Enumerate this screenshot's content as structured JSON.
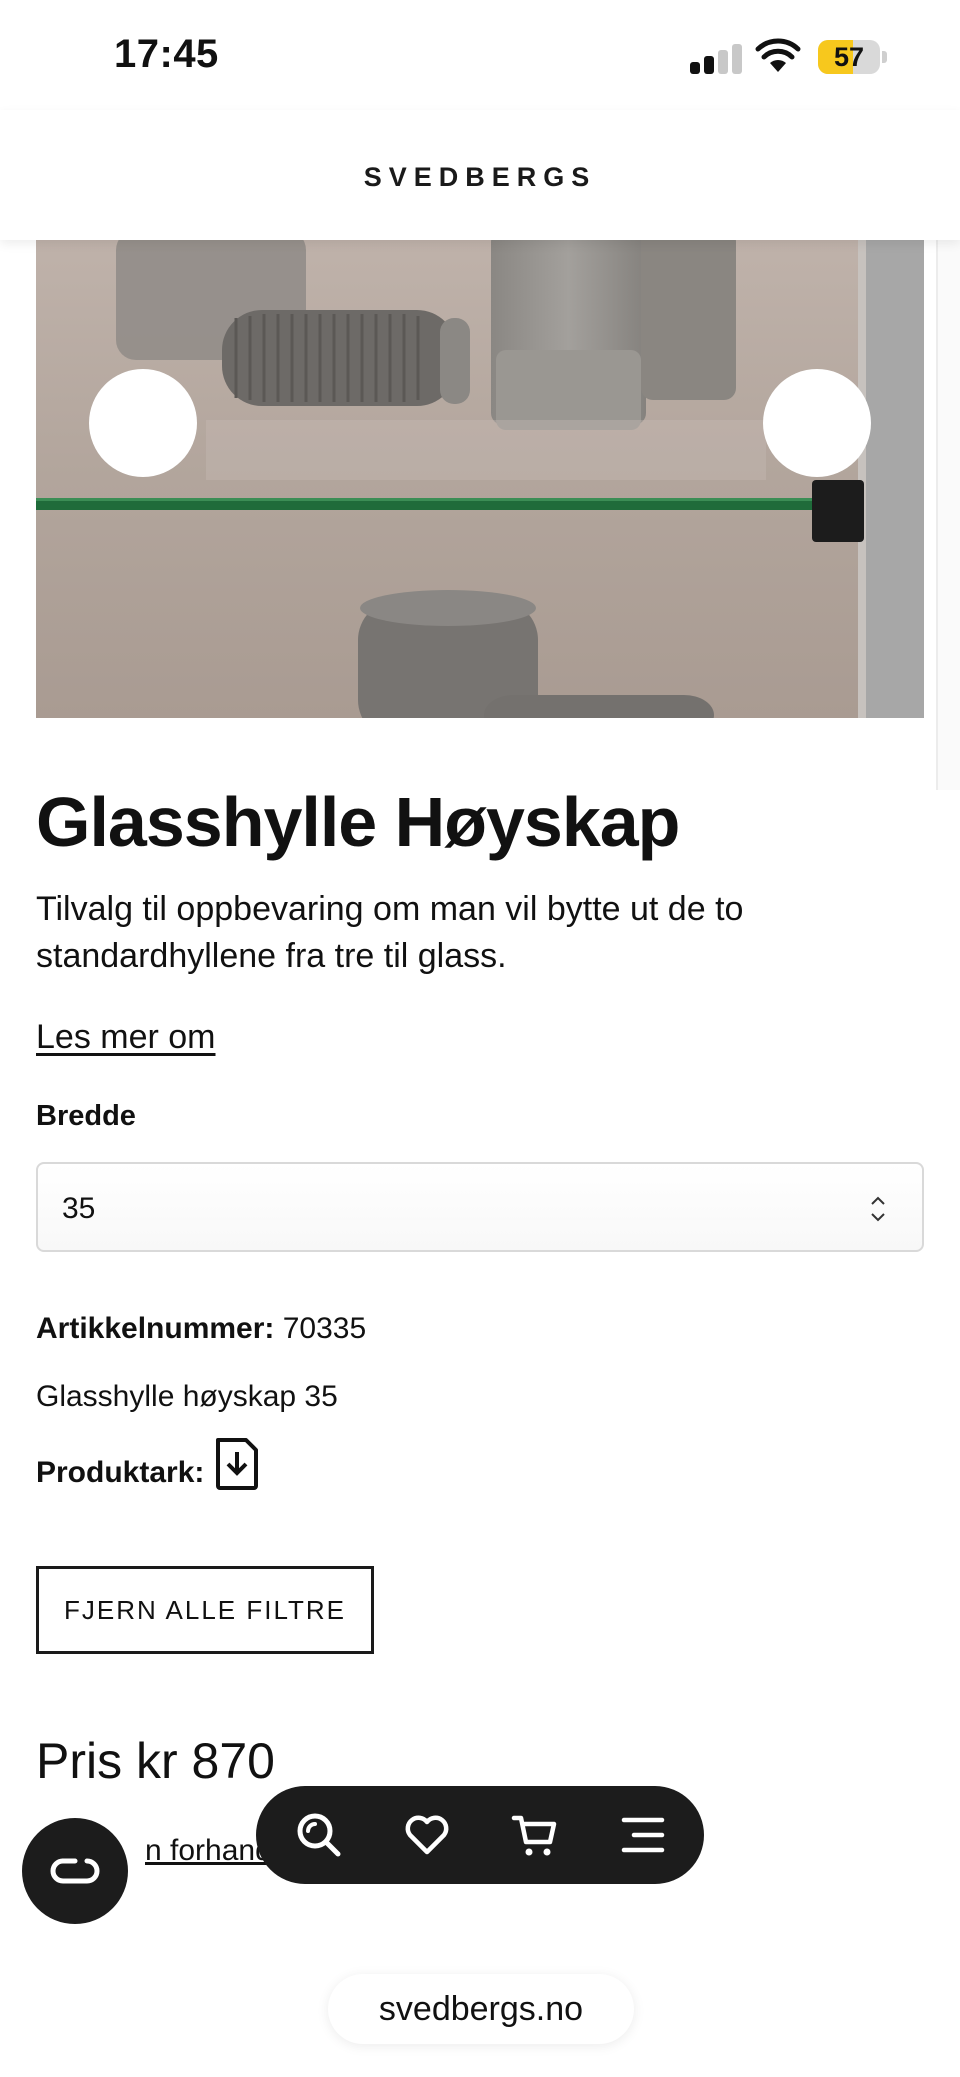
{
  "status_bar": {
    "time": "17:45",
    "battery_level": "57",
    "battery_fraction": 0.57,
    "battery_color": "#f7c81d",
    "signal_bars_active": 2,
    "signal_bars_total": 4
  },
  "header": {
    "logo": "SVEDBERGS"
  },
  "gallery": {
    "image_alt": "Glasshylle Høyskap product photo",
    "prev_icon": "chevron-left-icon",
    "next_icon": "chevron-right-icon"
  },
  "product": {
    "title": "Glasshylle Høyskap",
    "description": "Tilvalg til oppbevaring om man vil bytte ut de to standardhyllene fra tre til glass.",
    "read_more": "Les mer om",
    "width_label": "Bredde",
    "width_value": "35",
    "article_label": "Artikkelnummer:",
    "article_number": "70335",
    "variant_name": "Glasshylle høyskap 35",
    "datasheet_label": "Produktark:",
    "datasheet_icon": "file-download-icon",
    "clear_filters": "FJERN ALLE FILTRE",
    "price": "Pris kr 870",
    "dealer_link_visible": "n forhandl"
  },
  "floating": {
    "chat_icon": "chat-glasses-icon",
    "nav_icons": [
      "search-icon",
      "heart-icon",
      "cart-icon",
      "menu-icon"
    ]
  },
  "browser": {
    "url": "svedbergs.no"
  },
  "colors": {
    "accent_dark": "#1c1c1c",
    "shelf_glass": "#1f6b3a",
    "battery": "#f7c81d"
  }
}
